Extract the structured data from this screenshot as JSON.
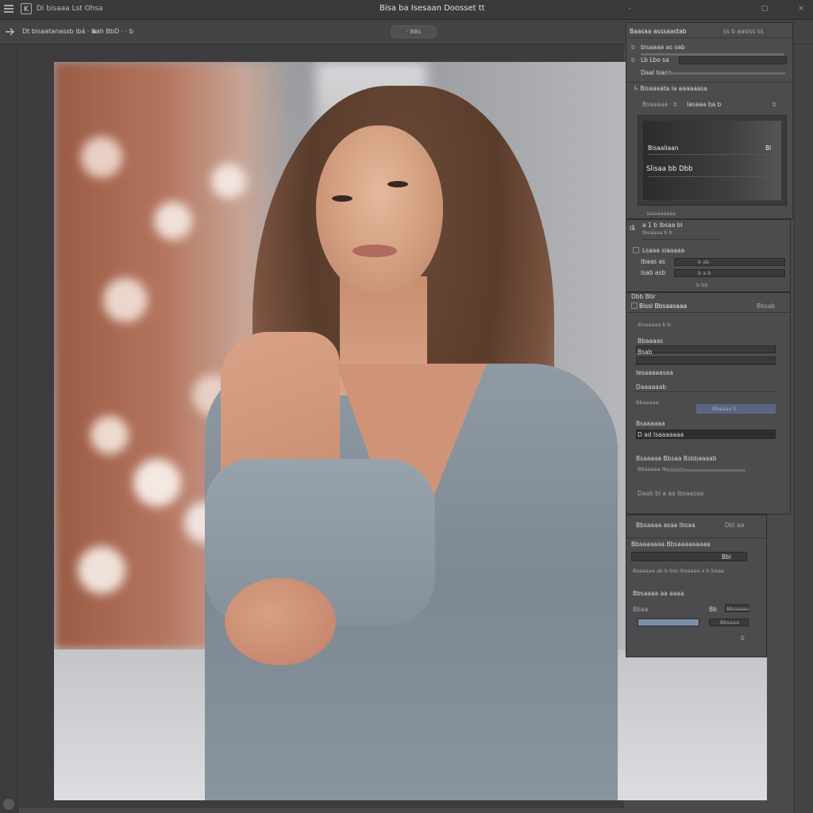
{
  "titlebar": {
    "app_badge": "K",
    "doc_name": "Di bisaaa Lst Ohsa",
    "window_title": "Bisa ba Isesaan Doosset tt",
    "controls": [
      "-",
      "□",
      "×"
    ]
  },
  "options_bar": {
    "tool_name": "Dt bisaatanassb ibá · lk",
    "tool_value": "aah BbD · · b",
    "mode_pill": "· BBs"
  },
  "panel_top": {
    "header": "Baasaa asssaastab",
    "header_right": "ss b aasiss ss",
    "rows": [
      {
        "icon": "b",
        "label": "bisaaaa as sab"
      },
      {
        "icon": "b",
        "label": "Lb Lbo sa"
      },
      {
        "icon": "",
        "label": "Daal Isasa"
      }
    ],
    "section": "I- Bisaaaata la aaaaaasa",
    "select_label": "Bsaaaaa · b",
    "select_value": "Iasaaa ba b",
    "select_right": "b",
    "preview": {
      "line1": "Bisaaliaan",
      "line1_right": "Bl",
      "line2": "Slisaa bb Dbb"
    },
    "footer": "Issaaaaasa"
  },
  "panel_mid": {
    "header_icon": "Iå",
    "header": "a 1 b Ibsaa bl",
    "header_sub": "Ibsaaaa b b",
    "rows": [
      {
        "label": "Lsaaa siaaaaa",
        "value": ""
      },
      {
        "label": "Ibaas as",
        "value": "b ab"
      },
      {
        "label": "Isab asb",
        "value": "b a b"
      }
    ],
    "footer": "b bb"
  },
  "panel_props": {
    "caption": "Dbb Bbr",
    "header": "Bissl Bbsaasaaa",
    "header_right": "Bbsab",
    "sub": "Ibsaaaaa b b",
    "fields": [
      {
        "label": "Bbaaaas",
        "value": ""
      },
      {
        "label": "Bsab",
        "value": ""
      }
    ],
    "group1": "Iesaaaaasaa",
    "group2": "Daaaaaab",
    "group3_label": "Bbaaaaa",
    "group3_value": "Bbaaaa b",
    "group4_label": "Bsaaaaaa",
    "group4_value": "D ad Isaaaaaaa",
    "group5": "Bsaaaaa Bbsaa Bsbbaaaab",
    "group5_sub": "Bbaaaaa Ibsaaaaa",
    "footer": "Daab bl a aa Ibsaasaa"
  },
  "panel_bottom": {
    "header": "Bbsaaaa asaa lbsaa",
    "header_right": "Dbl aa",
    "row1": "Bbaaaaaaa Bbsaaaaaaaaa",
    "row1_right": "Bbi",
    "row2": "Basaaaa ab b bss Ibsaaaa a b baaa",
    "group": "Bbsaaaa aa aaaa",
    "field1_label": "Bbaa",
    "field1_value": "Bb",
    "field1_right": "Bbsaaaa",
    "field2_right": "Bbsaaa",
    "footer_num": "b"
  },
  "colors": {
    "panel_bg": "#4c4c4e",
    "workspace_bg": "#3d3d3f",
    "accent_blue": "#7d8fa8"
  }
}
